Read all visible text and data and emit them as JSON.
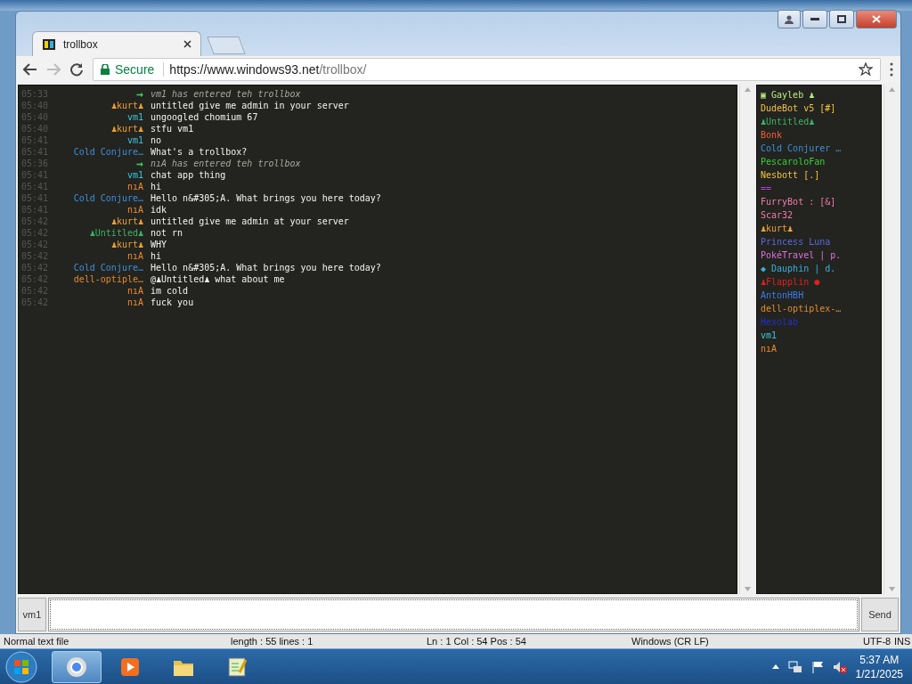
{
  "background_window": {
    "status": [
      "Normal text file",
      "length : 55    lines : 1",
      "Ln : 1    Col : 54    Pos : 54",
      "Windows (CR LF)",
      "UTF-8",
      "INS"
    ]
  },
  "browser": {
    "tabs": [
      {
        "title": "trollbox",
        "selected": true
      }
    ],
    "security": "Secure",
    "url_host": "https://www.windows93.net",
    "url_path": "/trollbox/"
  },
  "messages": [
    {
      "kind": "system",
      "time": "05:33",
      "name": "→",
      "color": "#3ecf5a",
      "text": "vm1 has entered teh trollbox"
    },
    {
      "kind": "message",
      "time": "05:40",
      "name": "♟kurt♟",
      "color": "#f0a030",
      "text": "untitled give me admin in your server"
    },
    {
      "kind": "message",
      "time": "05:40",
      "name": "vm1",
      "color": "#3fc1d8",
      "text": "ungoogled chomium 67"
    },
    {
      "kind": "message",
      "time": "05:40",
      "name": "♟kurt♟",
      "color": "#f0a030",
      "text": "stfu vm1"
    },
    {
      "kind": "message",
      "time": "05:41",
      "name": "vm1",
      "color": "#3fc1d8",
      "text": "no"
    },
    {
      "kind": "message",
      "time": "05:41",
      "name": "Cold Conjure…",
      "color": "#3a8fe0",
      "text": "What's a trollbox?"
    },
    {
      "kind": "system",
      "time": "05:36",
      "name": "→",
      "color": "#3ecf5a",
      "text": "nıA has entered teh trollbox"
    },
    {
      "kind": "message",
      "time": "05:41",
      "name": "vm1",
      "color": "#3fc1d8",
      "text": "chat app thing"
    },
    {
      "kind": "message",
      "time": "05:41",
      "name": "nıA",
      "color": "#f08a30",
      "text": "hi"
    },
    {
      "kind": "message",
      "time": "05:41",
      "name": "Cold Conjure…",
      "color": "#3a8fe0",
      "text": "Hello n&#305;A. What brings you here today?"
    },
    {
      "kind": "message",
      "time": "05:41",
      "name": "nıA",
      "color": "#f08a30",
      "text": "idk"
    },
    {
      "kind": "message",
      "time": "05:42",
      "name": "♟kurt♟",
      "color": "#f0a030",
      "text": "untitled give me admin at your server"
    },
    {
      "kind": "message",
      "time": "05:42",
      "name": "♟Untitled♟",
      "color": "#3cb36a",
      "text": "not rn"
    },
    {
      "kind": "message",
      "time": "05:42",
      "name": "♟kurt♟",
      "color": "#f0a030",
      "text": "WHY"
    },
    {
      "kind": "message",
      "time": "05:42",
      "name": "nıA",
      "color": "#f08a30",
      "text": "hi"
    },
    {
      "kind": "message",
      "time": "05:42",
      "name": "Cold Conjure…",
      "color": "#3a8fe0",
      "text": "Hello n&#305;A. What brings you here today?"
    },
    {
      "kind": "message",
      "time": "05:42",
      "name": "dell-optiple…",
      "color": "#e08a30",
      "text": "@♟Untitled♟ what about me"
    },
    {
      "kind": "message",
      "time": "05:42",
      "name": "nıA",
      "color": "#f08a30",
      "text": "im cold"
    },
    {
      "kind": "message",
      "time": "05:42",
      "name": "nıA",
      "color": "#f08a30",
      "text": "fuck you"
    }
  ],
  "users": [
    {
      "name": "▣ Gayleb ♟",
      "color": "#b8e986"
    },
    {
      "name": "DudeBot v5 [#]",
      "color": "#f5c242"
    },
    {
      "name": "♟Untitled♟",
      "color": "#3cb36a"
    },
    {
      "name": "Bonk",
      "color": "#f0603a"
    },
    {
      "name": "Cold Conjurer …",
      "color": "#3a8fe0"
    },
    {
      "name": "PescaroloFan",
      "color": "#3ad03a"
    },
    {
      "name": "Nesbott [.]",
      "color": "#f5c242"
    },
    {
      "name": "==",
      "color": "#b040d0"
    },
    {
      "name": "FurryBot : [&]",
      "color": "#f07ab0"
    },
    {
      "name": "Scar32",
      "color": "#f07ab0"
    },
    {
      "name": "♟kurt♟",
      "color": "#f0a030"
    },
    {
      "name": "Princess Luna",
      "color": "#5a6ae0"
    },
    {
      "name": "PokéTravel | p.",
      "color": "#e070e0"
    },
    {
      "name": "◆ Dauphin | d.",
      "color": "#3ab0e0"
    },
    {
      "name": "♟Flapplin ●",
      "color": "#e02020"
    },
    {
      "name": "AntonHBH",
      "color": "#3a7af0"
    },
    {
      "name": "dell-optiplex-…",
      "color": "#e08a30"
    },
    {
      "name": "Hexolab",
      "color": "#2030d0"
    },
    {
      "name": "vm1",
      "color": "#3fc1d8"
    },
    {
      "name": "nıA",
      "color": "#f08a30"
    }
  ],
  "input": {
    "nick": "vm1",
    "button": "Send"
  },
  "taskbar": {
    "time": "5:37 AM",
    "date": "1/21/2025",
    "apps": [
      {
        "selected": true
      },
      {
        "selected": false
      },
      {
        "selected": false
      },
      {
        "selected": false
      }
    ]
  }
}
